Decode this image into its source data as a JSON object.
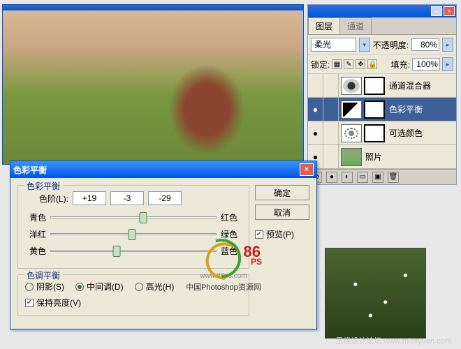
{
  "layers_panel": {
    "tabs": {
      "layers": "图层",
      "channels": "通道"
    },
    "blend_mode": "柔光",
    "opacity_label": "不透明度:",
    "opacity_value": "80%",
    "lock_label": "锁定:",
    "fill_label": "填充:",
    "fill_value": "100%",
    "rows": [
      {
        "name": "通道混合器",
        "eye": ""
      },
      {
        "name": "色彩平衡",
        "eye": "●"
      },
      {
        "name": "可选颜色",
        "eye": "●"
      },
      {
        "name": "照片",
        "eye": "●"
      }
    ]
  },
  "dialog": {
    "title": "色彩平衡",
    "ok": "确定",
    "cancel": "取消",
    "preview": "预览(P)",
    "group_balance": "色彩平衡",
    "levels_label": "色阶(L):",
    "levels": [
      "+19",
      "-3",
      "-29"
    ],
    "sliders": [
      {
        "left": "青色",
        "right": "红色",
        "pos": 56
      },
      {
        "left": "洋红",
        "right": "绿色",
        "pos": 49
      },
      {
        "left": "黄色",
        "right": "蓝色",
        "pos": 40
      }
    ],
    "group_tone": "色调平衡",
    "tones": {
      "shadows": "阴影(S)",
      "midtones": "中间调(D)",
      "highlights": "高光(H)"
    },
    "preserve": "保持亮度(V)"
  },
  "watermark": {
    "eighty": "86",
    "ps": "PS",
    "caption": "中国Photoshop资源网",
    "url": "www.86ps.com",
    "footer": "思缘设计论坛   www.missyuan.com"
  }
}
